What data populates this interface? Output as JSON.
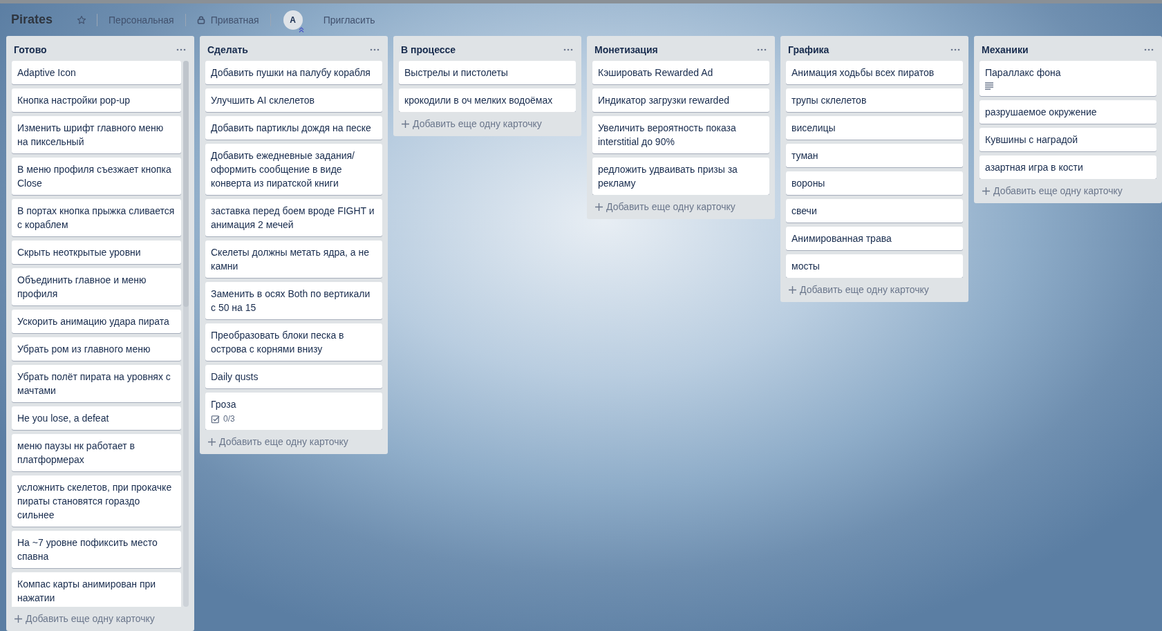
{
  "board": {
    "title": "Pirates",
    "starred": false,
    "team": "Персональная",
    "visibility": "Приватная",
    "member_initial": "A",
    "invite": "Пригласить"
  },
  "lists": [
    {
      "title": "Готово",
      "scrollable": true,
      "cards": [
        {
          "text": "Adaptive Icon"
        },
        {
          "text": "Кнопка настройки pop-up"
        },
        {
          "text": "Изменить шрифт главного меню на пиксельный"
        },
        {
          "text": "В меню профиля съезжает кнопка Close"
        },
        {
          "text": "В портах кнопка прыжка сливается с кораблем"
        },
        {
          "text": "Скрыть неоткрытые уровни"
        },
        {
          "text": "Объединить главное и меню профиля"
        },
        {
          "text": "Ускорить анимацию удара пирата"
        },
        {
          "text": "Убрать ром из главного меню"
        },
        {
          "text": "Убрать полёт пирата на уровнях с мачтами"
        },
        {
          "text": "He you lose, a defeat"
        },
        {
          "text": "меню паузы нк работает в платформерах"
        },
        {
          "text": "усложнить скелетов, при прокачке пираты становятся гораздо сильнее"
        },
        {
          "text": "На ~7 уровне пофиксить место спавна"
        },
        {
          "text": "Компас карты анимирован при нажатии"
        }
      ],
      "add": "Добавить еще одну карточку"
    },
    {
      "title": "Сделать",
      "scrollable": false,
      "cards": [
        {
          "text": "Добавить пушки на палубу корабля"
        },
        {
          "text": "Улучшить AI склелетов"
        },
        {
          "text": "Добавить партиклы дождя на песке"
        },
        {
          "text": "Добавить ежедневные задания/ оформить сообщение в виде конверта из пиратской книги"
        },
        {
          "text": "заставка перед боем вроде FIGHT и анимация 2 мечей"
        },
        {
          "text": "Скелеты должны метать ядра, а не камни"
        },
        {
          "text": "Заменить в осях Both по вертикали с 50 на 15"
        },
        {
          "text": "Преобразовать блоки песка в острова с корнями внизу"
        },
        {
          "text": "Daily qusts"
        },
        {
          "text": "Гроза",
          "badges": [
            {
              "kind": "checklist",
              "text": "0/3"
            }
          ]
        }
      ],
      "add": "Добавить еще одну карточку"
    },
    {
      "title": "В процессе",
      "scrollable": false,
      "cards": [
        {
          "text": "Выстрелы и пистолеты"
        },
        {
          "text": "крокодили в оч мелких водоёмах"
        }
      ],
      "add": "Добавить еще одну карточку"
    },
    {
      "title": "Монетизация",
      "scrollable": false,
      "cards": [
        {
          "text": "Кэшировать Rewarded Ad"
        },
        {
          "text": "Индикатор загрузки rewarded"
        },
        {
          "text": "Увеличить вероятность показа interstitial до 90%"
        },
        {
          "text": "редложить удваивать призы за рекламу"
        }
      ],
      "add": "Добавить еще одну карточку"
    },
    {
      "title": "Графика",
      "scrollable": false,
      "cards": [
        {
          "text": "Анимация ходьбы всех пиратов"
        },
        {
          "text": "трупы склелетов"
        },
        {
          "text": "виселицы"
        },
        {
          "text": "туман"
        },
        {
          "text": "вороны"
        },
        {
          "text": "свечи"
        },
        {
          "text": "Анимированная трава"
        },
        {
          "text": "мосты"
        }
      ],
      "add": "Добавить еще одну карточку"
    },
    {
      "title": "Механики",
      "scrollable": false,
      "cards": [
        {
          "text": "Параллакс фона",
          "badges": [
            {
              "kind": "description"
            }
          ]
        },
        {
          "text": "разрушаемое окружение"
        },
        {
          "text": "Кувшины с наградой"
        },
        {
          "text": "азартная игра в кости"
        }
      ],
      "add": "Добавить еще одну карточку"
    }
  ]
}
